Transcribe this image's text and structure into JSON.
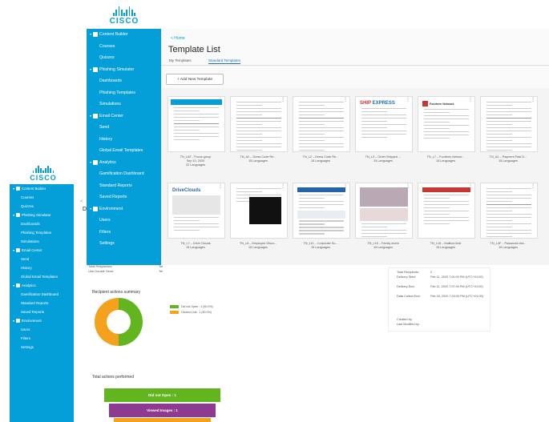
{
  "brand": {
    "name": "CISCO"
  },
  "colors": {
    "accent": "#049fd9",
    "link": "#1d6fb8",
    "donut_green": "#62b51f",
    "donut_orange": "#f4a11d",
    "funnel_green": "#62b51f",
    "funnel_purple": "#8e3a8e",
    "funnel_orange": "#f4a11d"
  },
  "sidebar": {
    "sections": [
      {
        "label": "Content Builder",
        "icon": "graduation-cap-icon",
        "items": [
          "Courses",
          "Quizzes"
        ]
      },
      {
        "label": "Phishing Simulator",
        "icon": "hook-icon",
        "items": [
          "Dashboards",
          "Phishing Templates",
          "Simulations"
        ]
      },
      {
        "label": "Email Center",
        "icon": "envelope-icon",
        "items": [
          "Send",
          "History",
          "Global Email Templates"
        ]
      },
      {
        "label": "Analytics",
        "icon": "chart-icon",
        "items": [
          "Gamification Dashboard",
          "Standard Reports",
          "Saved Reports"
        ]
      },
      {
        "label": "Environment",
        "icon": "building-icon",
        "items": [
          "Users",
          "Filters",
          "Settings"
        ]
      }
    ]
  },
  "front": {
    "breadcrumb": "< Home",
    "title": "Template List",
    "tabs": [
      {
        "label": "My Templates",
        "active": false
      },
      {
        "label": "Standard Templates",
        "active": true
      }
    ],
    "add_button": "+ Add New Template",
    "templates": [
      {
        "name": "TN_LAF - Focus group",
        "date": "Sep 10, 2020",
        "langs": "22 Languages"
      },
      {
        "name": "TN_A2 – Dress Code Re...",
        "langs": "15 Languages"
      },
      {
        "name": "TN_L2 – Dress Code Re...",
        "langs": "15 Languages"
      },
      {
        "name": "TN_L3 – Order Shipped ...",
        "langs": "15 Languages",
        "logo_a": "SHIP",
        "logo_b": "EXPRESS"
      },
      {
        "name": "TN_L7 – Fourteen Networ...",
        "langs": "15 Languages",
        "logo_a": "Fourteen Network"
      },
      {
        "name": "TN_A1 – Payment Past D...",
        "langs": "15 Languages"
      },
      {
        "name": "TN_L7 – Drive Clouds",
        "langs": "15 Languages",
        "logo_a": "DriveClouds"
      },
      {
        "name": "TN_L8 – Employee Disco...",
        "langs": "15 Languages"
      },
      {
        "name": "TN_L11 – Corporate So...",
        "langs": "15 Languages"
      },
      {
        "name": "TN_L15 – Family event",
        "langs": "15 Languages"
      },
      {
        "name": "TN_L16 – Mailbox limit",
        "langs": "15 Languages"
      },
      {
        "name": "TN_L4F – Password cha...",
        "langs": "15 Languages"
      }
    ]
  },
  "back": {
    "partial_heading": "Da",
    "scroll_arrow": "<",
    "left_rows": [
      "Total Responses",
      "Use Double Send"
    ],
    "right_rows": [
      "Tel",
      "Tel"
    ],
    "summary_title": "Recipient actions summary",
    "legend": [
      {
        "label": "Did not Open : 1 (50.0%)",
        "color": "#62b51f"
      },
      {
        "label": "Clicked Link : 1 (50.0%)",
        "color": "#f4a11d"
      }
    ],
    "donut": [
      {
        "label": "Did not Open",
        "value": 50
      },
      {
        "label": "Clicked Link",
        "value": 50
      }
    ],
    "funnel_title": "Total actions performed",
    "funnel": [
      {
        "label": "Did not Open : 1"
      },
      {
        "label": "Viewed Images : 1"
      }
    ],
    "info": [
      {
        "label": "Total Recipients:",
        "value": "2"
      },
      {
        "label": "Delivery Start:",
        "value": "Feb 11, 2020 7:00:00 PM (UTC+01:00)"
      },
      {
        "label": "Delivery End:",
        "value": "Feb 11, 2020 7:07:00 PM (UTC+01:00)"
      },
      {
        "label": "Data Collect End:",
        "value": "Feb 18, 2020 7:00:00 PM (UTC+01:00)"
      },
      {
        "label": "Created by:",
        "value": ""
      },
      {
        "label": "Last Modified by:",
        "value": ""
      }
    ]
  }
}
